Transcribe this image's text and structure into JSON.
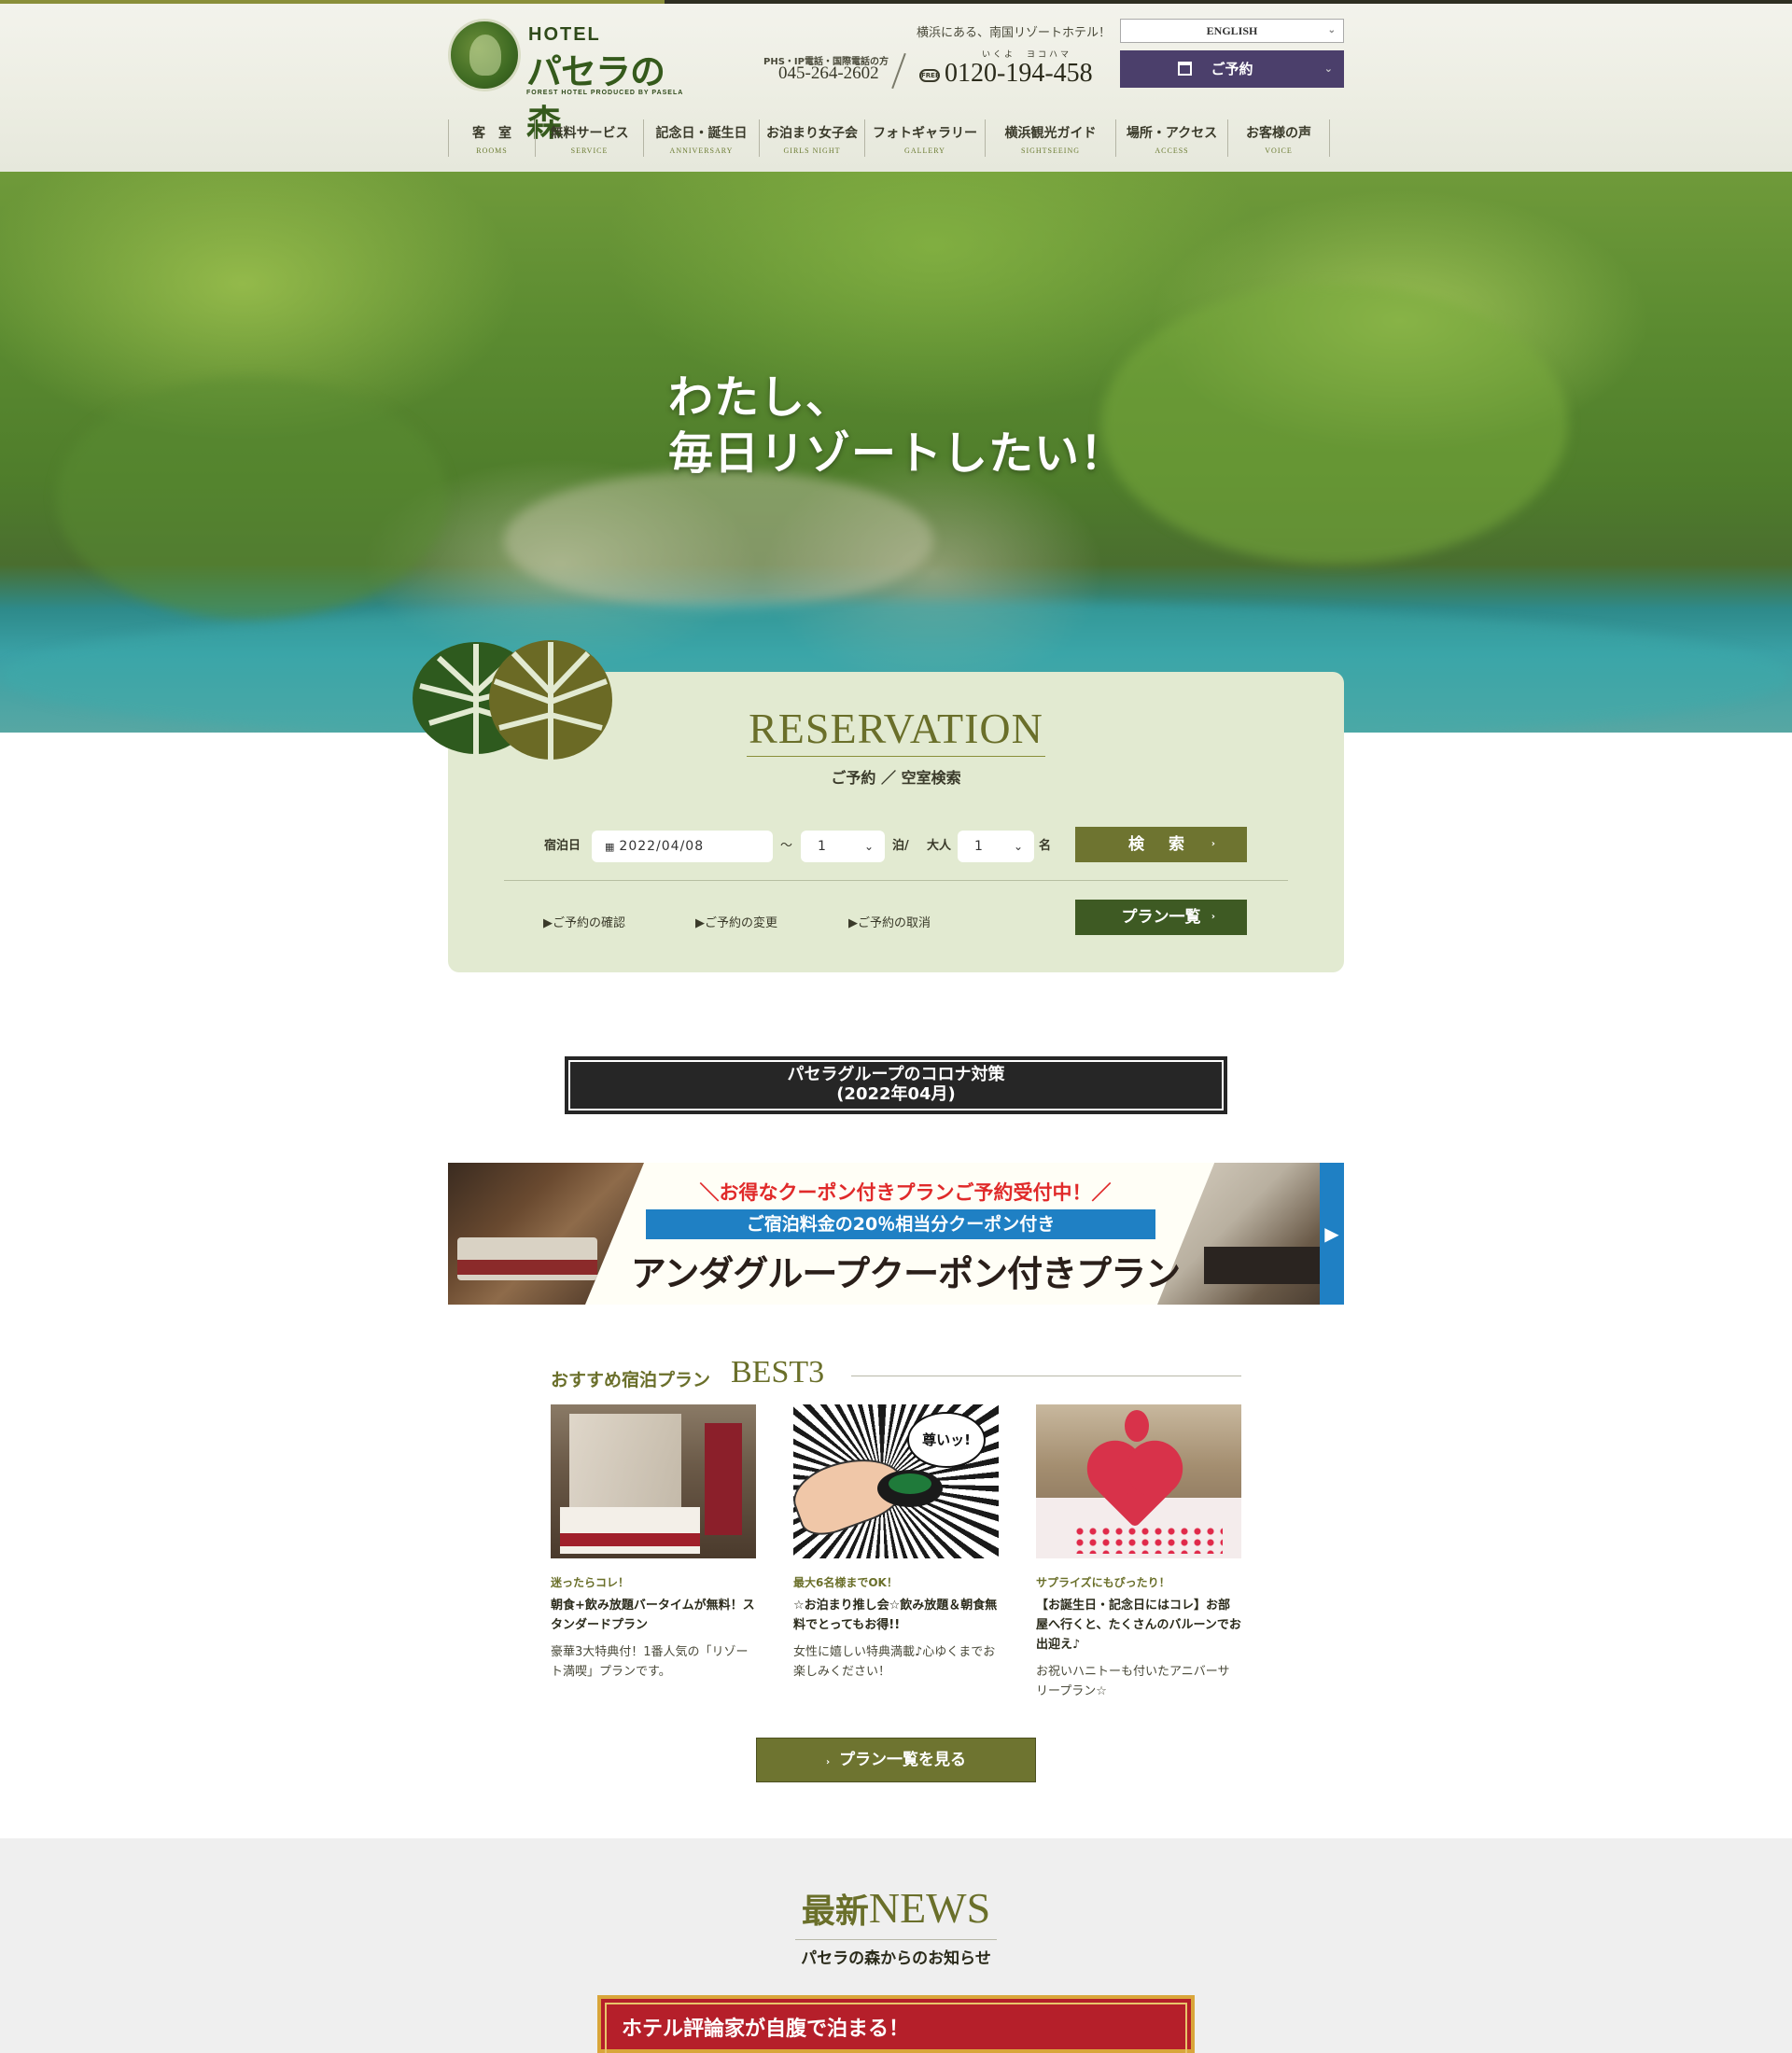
{
  "header": {
    "logo": {
      "hotel": "HOTEL",
      "name": "パセラの森",
      "sub": "FOREST HOTEL PRODUCED BY PASELA"
    },
    "tagline": "横浜にある、南国リゾートホテル！",
    "phs_label": "PHS・IP電話・国際電話の方",
    "phs_number": "045-264-2602",
    "free_ruby": "いくよ　ヨコハマ",
    "free_icon_label": "FREE",
    "free_number": "0120-194-458",
    "language": "ENGLISH",
    "reserve_label": "ご予約",
    "nav": [
      {
        "jp": "客　室",
        "en": "ROOMS"
      },
      {
        "jp": "無料サービス",
        "en": "SERVICE"
      },
      {
        "jp": "記念日・誕生日",
        "en": "ANNIVERSARY"
      },
      {
        "jp": "お泊まり女子会",
        "en": "GIRLS NIGHT"
      },
      {
        "jp": "フォトギャラリー",
        "en": "GALLERY"
      },
      {
        "jp": "横浜観光ガイド",
        "en": "SIGHTSEEING"
      },
      {
        "jp": "場所・アクセス",
        "en": "ACCESS"
      },
      {
        "jp": "お客様の声",
        "en": "VOICE"
      }
    ]
  },
  "hero": {
    "line1": "わたし、",
    "line2": "毎日リゾートしたい！"
  },
  "reservation": {
    "title": "RESERVATION",
    "subtitle": "ご予約 ／ 空室検索",
    "date_label": "宿泊日",
    "date_value": "2022/04/08",
    "tilde": "〜",
    "nights_value": "1",
    "nights_unit": "泊/",
    "adults_label": "大人",
    "adults_value": "1",
    "adults_unit": "名",
    "search_label": "検 索",
    "links": [
      "ご予約の確認",
      "ご予約の変更",
      "ご予約の取消"
    ],
    "plan_list_label": "プラン一覧"
  },
  "corona": {
    "line1": "パセラグループのコロナ対策",
    "line2": "(2022年04月)"
  },
  "banner": {
    "catch": "＼お得なクーポン付きプランご予約受付中！／",
    "blue": "ご宿泊料金の20％相当分クーポン付き",
    "main": "アンダグループクーポン付きプラン"
  },
  "best": {
    "heading_jp": "おすすめ宿泊プラン",
    "heading_en": "BEST3",
    "plans": [
      {
        "tag": "迷ったらコレ！",
        "title": "朝食+飲み放題バータイムが無料！スタンダードプラン",
        "desc": "豪華3大特典付！1番人気の「リゾート満喫」プランです。"
      },
      {
        "tag": "最大6名様までOK！",
        "title": "☆お泊まり推し会☆飲み放題＆朝食無料でとってもお得!!",
        "desc": "女性に嬉しい特典満載♪心ゆくまでお楽しみください！",
        "bubble": "尊いッ!"
      },
      {
        "tag": "サプライズにもぴったり！",
        "title": "【お誕生日・記念日にはコレ】お部屋へ行くと、たくさんのバルーンでお出迎え♪",
        "desc": "お祝いハニトーも付いたアニバーサリープラン☆"
      }
    ],
    "see_all": "プラン一覧を見る"
  },
  "news": {
    "title_jp": "最新",
    "title_en": "NEWS",
    "subtitle": "パセラの森からのお知らせ",
    "card_text": "ホテル評論家が自腹で泊まる！"
  },
  "colors": {
    "olive": "#6e7430",
    "dark_green": "#3e5a23",
    "purple": "#4b3f6b",
    "coupon_blue": "#1f80c4",
    "coupon_red": "#e02a2a"
  }
}
